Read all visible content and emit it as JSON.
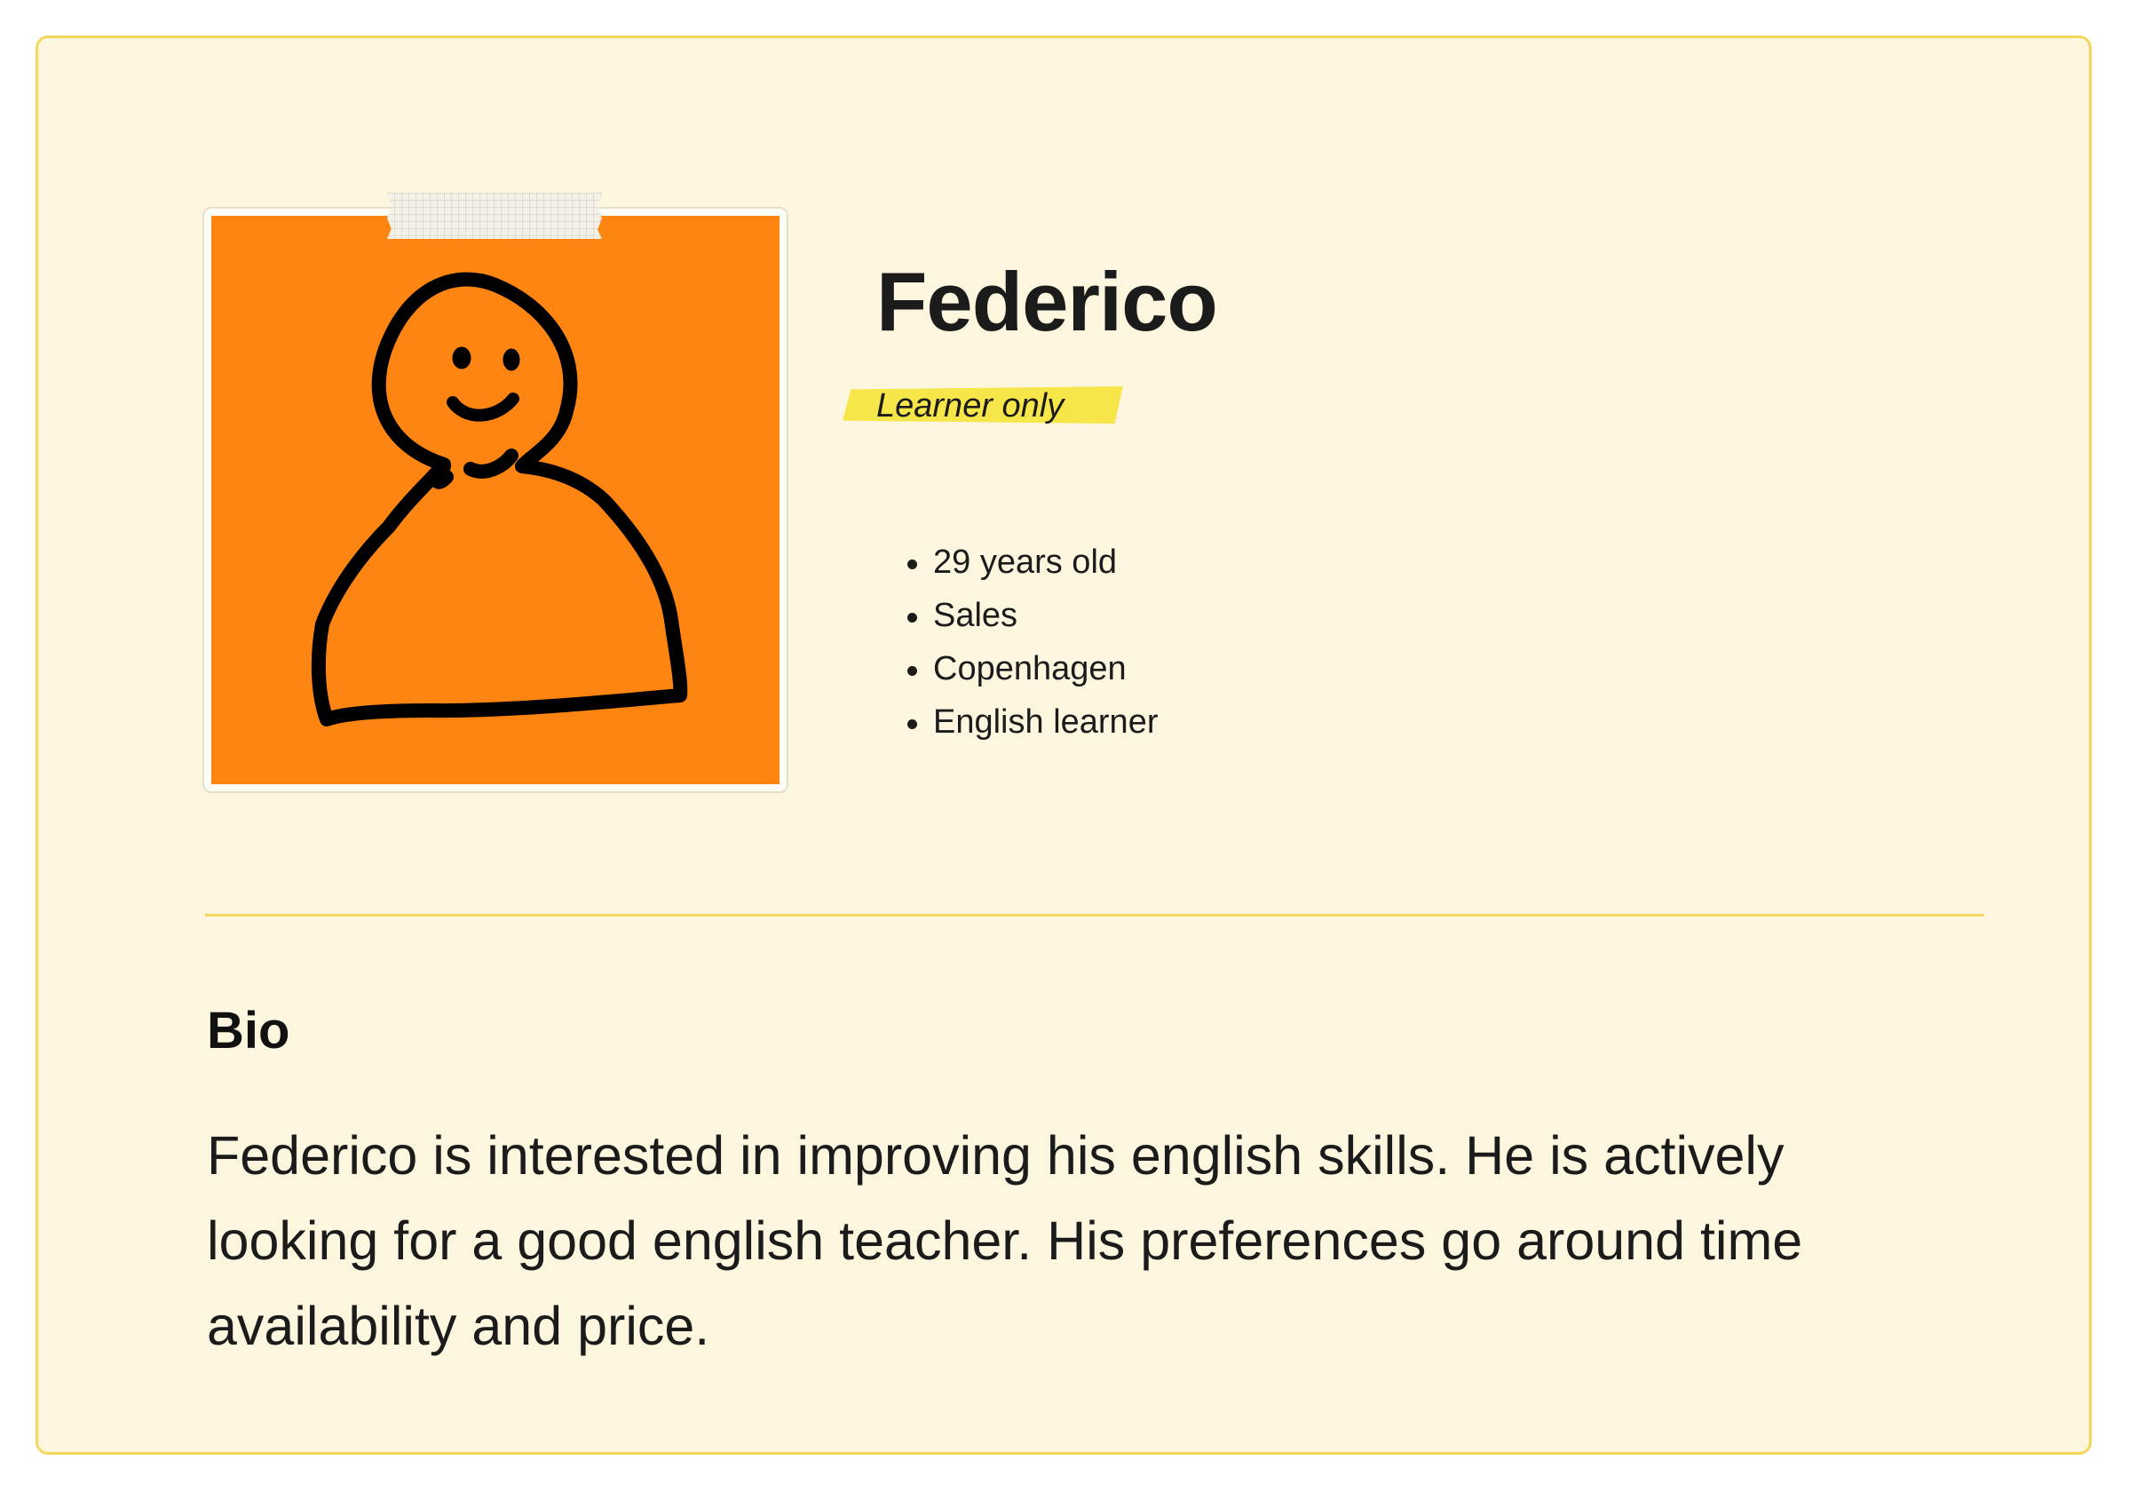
{
  "profile": {
    "name": "Federico",
    "badge": "Learner only",
    "facts": [
      "29 years old",
      "Sales",
      "Copenhagen",
      "English learner"
    ]
  },
  "bio": {
    "title": "Bio",
    "text": "Federico is interested in improving his english skills. He is actively looking for a good english teacher. His preferences go around time availability and price."
  },
  "avatar": {
    "icon": "doodle-person-icon",
    "color": "#ff8512"
  },
  "colors": {
    "card_background": "#fdf6df",
    "card_border": "#f5d65c",
    "badge_highlight": "#f7e64a",
    "text": "#1b1b1b"
  }
}
